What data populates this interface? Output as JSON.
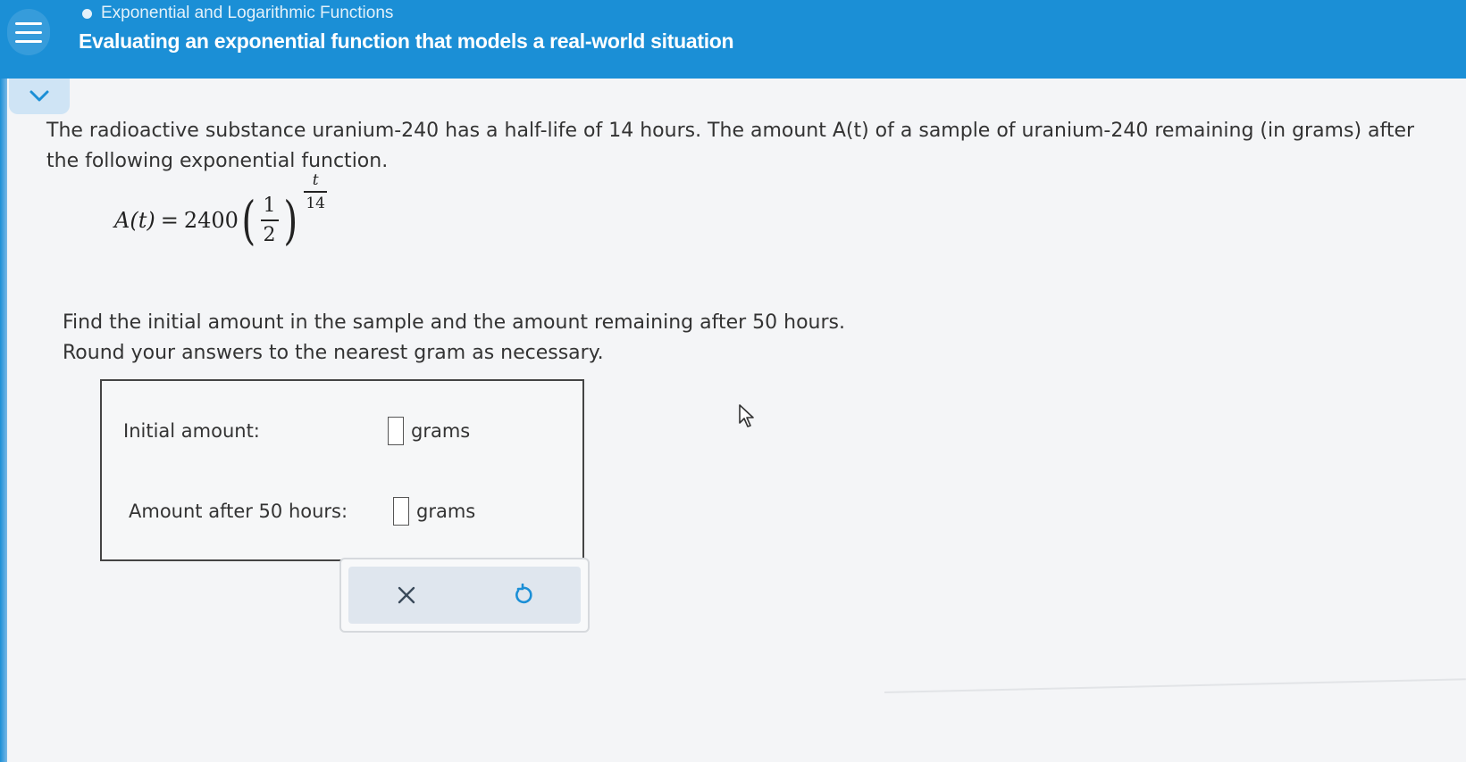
{
  "header": {
    "topic": "Exponential and Logarithmic Functions",
    "title": "Evaluating an exponential function that models a real-world situation"
  },
  "problem": {
    "line1": "The radioactive substance uranium-240 has a half-life of 14 hours. The amount A(t) of a sample of uranium-240 remaining (in grams) after",
    "line2": "the following exponential function.",
    "formula": {
      "lhs": "A(t)",
      "equals": "=",
      "coefficient": "2400",
      "base_num": "1",
      "base_den": "2",
      "exp_num": "t",
      "exp_den": "14"
    },
    "instruction1": "Find the initial amount in the sample and the amount remaining after 50 hours.",
    "instruction2": "Round your answers to the nearest gram as necessary."
  },
  "answers": {
    "initial_label": "Initial amount:",
    "initial_value": "",
    "initial_unit": "grams",
    "after_label": "Amount after 50 hours:",
    "after_value": "",
    "after_unit": "grams"
  },
  "icons": {
    "menu": "hamburger-menu-icon",
    "collapse": "chevron-down-icon",
    "clear": "x-icon",
    "undo": "undo-icon",
    "cursor": "mouse-pointer-icon"
  },
  "colors": {
    "header_bg": "#1b8fd6",
    "accent": "#1b8fd6",
    "clear_icon": "#3a4a5a"
  }
}
